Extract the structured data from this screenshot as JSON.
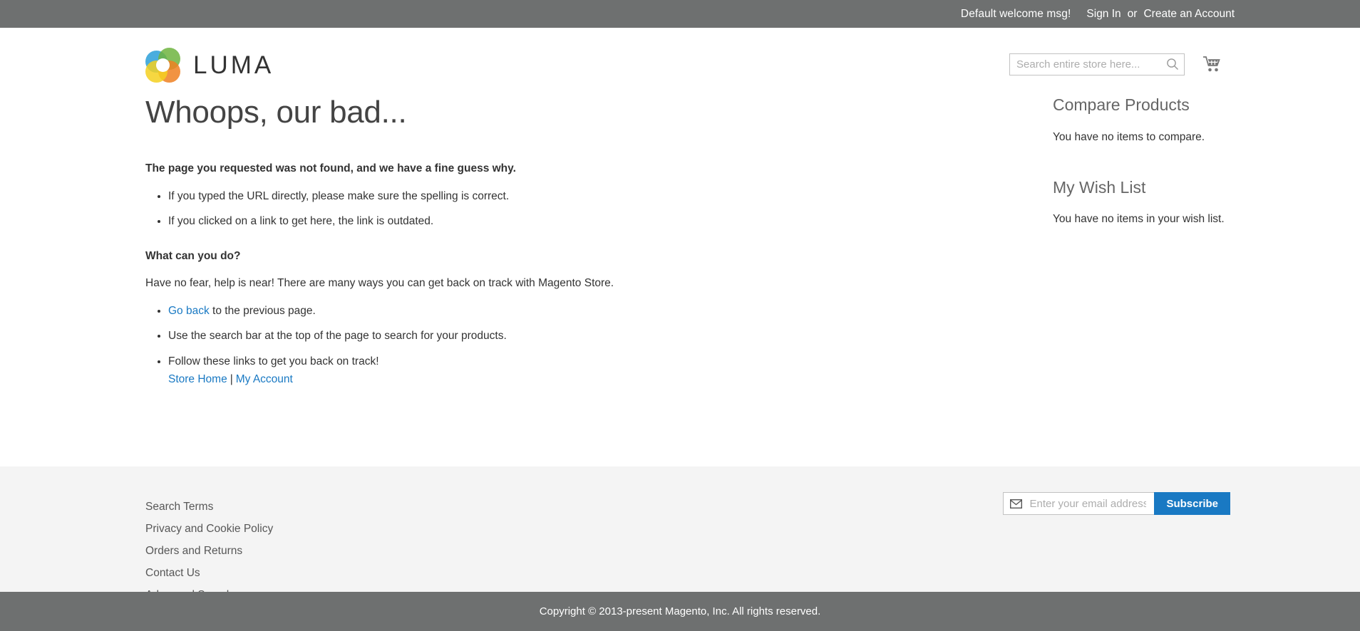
{
  "top_panel": {
    "welcome": "Default welcome msg!",
    "sign_in": "Sign In",
    "separator": "or",
    "create_account": "Create an Account"
  },
  "header": {
    "logo_text": "LUMA",
    "logo_icon": "luma-circles-logo",
    "search": {
      "placeholder": "Search entire store here...",
      "value": "",
      "icon": "search-icon"
    },
    "cart": {
      "icon": "shopping-cart-icon"
    }
  },
  "page": {
    "title": "Whoops, our bad...",
    "not_found_heading": "The page you requested was not found, and we have a fine guess why.",
    "reasons": [
      "If you typed the URL directly, please make sure the spelling is correct.",
      "If you clicked on a link to get here, the link is outdated."
    ],
    "what_heading": "What can you do?",
    "what_intro": "Have no fear, help is near! There are many ways you can get back on track with Magento Store.",
    "action_go_back_link": "Go back",
    "action_go_back_rest": " to the previous page.",
    "action_search": "Use the search bar at the top of the page to search for your products.",
    "action_follow": "Follow these links to get you back on track!",
    "store_home_link": "Store Home",
    "link_separator": "|",
    "my_account_link": "My Account"
  },
  "sidebar": {
    "compare": {
      "title": "Compare Products",
      "empty": "You have no items to compare."
    },
    "wishlist": {
      "title": "My Wish List",
      "empty": "You have no items in your wish list."
    }
  },
  "footer": {
    "links": [
      "Search Terms",
      "Privacy and Cookie Policy",
      "Orders and Returns",
      "Contact Us",
      "Advanced Search"
    ],
    "newsletter": {
      "icon": "envelope-icon",
      "placeholder": "Enter your email address",
      "value": "",
      "subscribe_label": "Subscribe"
    }
  },
  "copyright": {
    "text": "Copyright © 2013-present Magento, Inc. All rights reserved."
  },
  "colors": {
    "panel_gray": "#6e7070",
    "link_blue": "#1979c3",
    "footer_gray": "#f4f4f4"
  }
}
